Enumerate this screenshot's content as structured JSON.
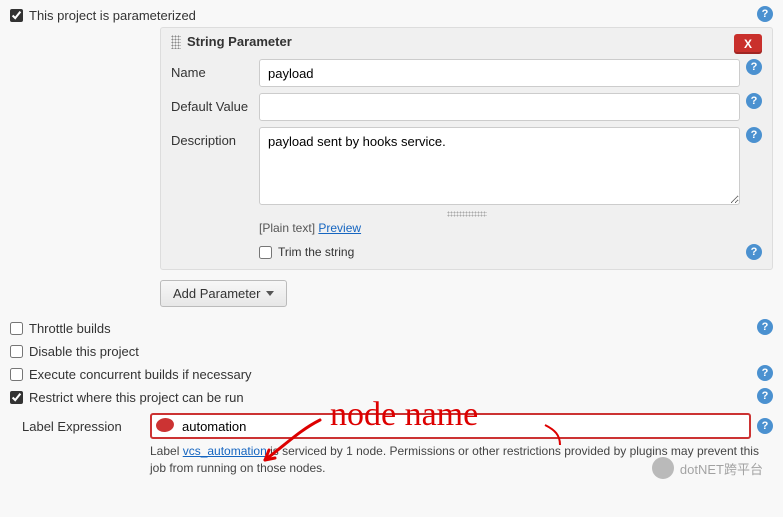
{
  "parameterized": {
    "label": "This project is parameterized",
    "checked": true
  },
  "string_parameter": {
    "title": "String Parameter",
    "close": "X",
    "name_label": "Name",
    "name_value": "payload",
    "default_label": "Default Value",
    "default_value": "",
    "description_label": "Description",
    "description_value": "payload sent by hooks service.",
    "plain_text": "[Plain text]",
    "preview": "Preview",
    "trim_label": "Trim the string",
    "trim_checked": false
  },
  "add_parameter_label": "Add Parameter",
  "options": {
    "throttle": {
      "label": "Throttle builds",
      "checked": false
    },
    "disable": {
      "label": "Disable this project",
      "checked": false
    },
    "concurrent": {
      "label": "Execute concurrent builds if necessary",
      "checked": false
    },
    "restrict": {
      "label": "Restrict where this project can be run",
      "checked": true
    }
  },
  "label_expression": {
    "label": "Label Expression",
    "value": "automation",
    "description_prefix": "Label ",
    "description_link": "vcs_automation",
    "description_suffix": " is serviced by 1 node. Permissions or other restrictions provided by plugins may prevent this job from running on those nodes."
  },
  "annotation": {
    "text": "node name"
  },
  "watermark": "dotNET跨平台"
}
